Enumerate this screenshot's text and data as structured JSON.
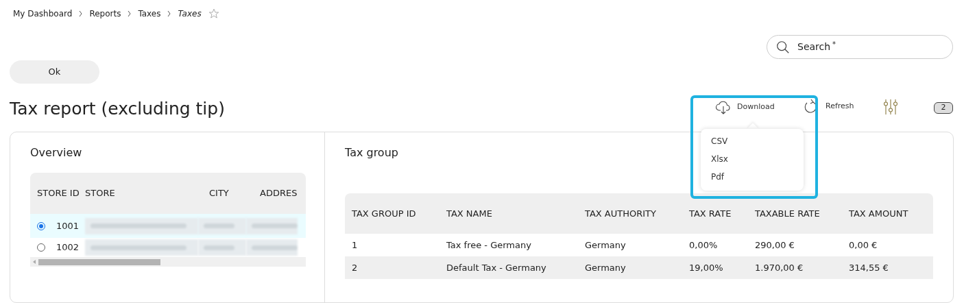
{
  "breadcrumb": [
    {
      "label": "My Dashboard",
      "current": false
    },
    {
      "label": "Reports",
      "current": false
    },
    {
      "label": "Taxes",
      "current": false
    },
    {
      "label": "Taxes",
      "current": true
    }
  ],
  "favorite": {
    "on": false
  },
  "search": {
    "placeholder": "Search",
    "required_mark": "*"
  },
  "ok_button": "Ok",
  "title": "Tax report (excluding tip)",
  "toolbar": {
    "download": "Download",
    "refresh": "Refresh",
    "badge": "2"
  },
  "download_menu": {
    "expanded": true,
    "items": [
      "CSV",
      "Xlsx",
      "Pdf"
    ]
  },
  "overview": {
    "title": "Overview",
    "columns": [
      "STORE ID",
      "STORE",
      "CITY",
      "ADDRES"
    ],
    "rows": [
      {
        "store_id": "1001",
        "selected": true
      },
      {
        "store_id": "1002",
        "selected": false
      }
    ]
  },
  "tax_group": {
    "title": "Tax group",
    "columns": [
      "TAX GROUP ID",
      "TAX NAME",
      "TAX AUTHORITY",
      "TAX RATE",
      "TAXABLE RATE",
      "TAX AMOUNT"
    ],
    "rows": [
      [
        "1",
        "Tax free - Germany",
        "Germany",
        "0,00%",
        "290,00 €",
        "0,00 €"
      ],
      [
        "2",
        "Default Tax - Germany",
        "Germany",
        "19,00%",
        "1.970,00 €",
        "314,55 €"
      ]
    ]
  }
}
